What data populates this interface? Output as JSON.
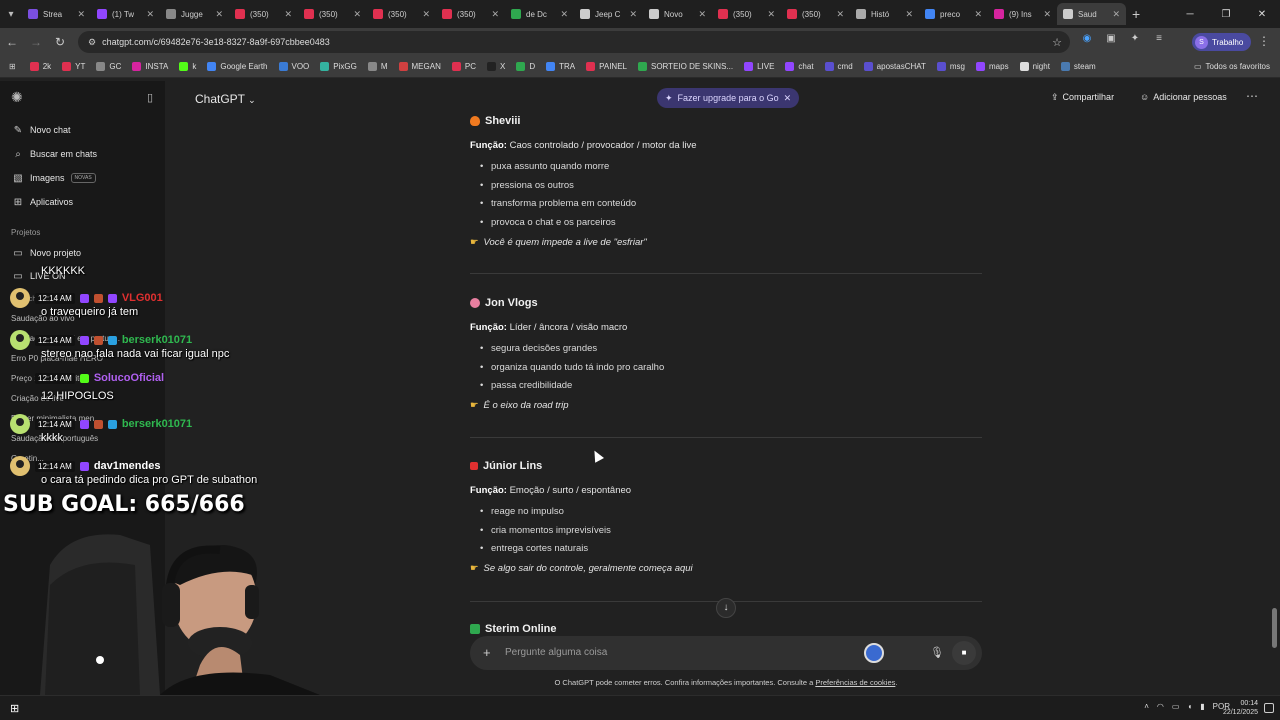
{
  "browser": {
    "tabs": [
      {
        "title": "Strea",
        "color": "#7b4fe0"
      },
      {
        "title": "(1) Tw",
        "color": "#9146ff"
      },
      {
        "title": "Jugge",
        "color": "#888888"
      },
      {
        "title": "(350)",
        "color": "#e03050"
      },
      {
        "title": "(350)",
        "color": "#e03050"
      },
      {
        "title": "(350)",
        "color": "#e03050"
      },
      {
        "title": "(350)",
        "color": "#e03050"
      },
      {
        "title": "de Dc",
        "color": "#2fa84f"
      },
      {
        "title": "Jeep C",
        "color": "#cccccc"
      },
      {
        "title": "Novo",
        "color": "#cccccc"
      },
      {
        "title": "(350)",
        "color": "#e03050"
      },
      {
        "title": "(350)",
        "color": "#e03050"
      },
      {
        "title": "Histó",
        "color": "#aaaaaa"
      },
      {
        "title": "preco",
        "color": "#4285f4"
      },
      {
        "title": "(9) Ins",
        "color": "#d6249f"
      },
      {
        "title": "Saud",
        "color": "#cccccc",
        "active": true
      }
    ],
    "url": "chatgpt.com/c/69482e76-3e18-8327-8a9f-697cbbee0483",
    "profile_name": "Trabalho",
    "profile_initial": "S",
    "bookmarks": [
      {
        "label": "2k",
        "color": "#e03050"
      },
      {
        "label": "YT",
        "color": "#e03050"
      },
      {
        "label": "GC",
        "color": "#888888"
      },
      {
        "label": "INSTA",
        "color": "#d6249f"
      },
      {
        "label": "k",
        "color": "#53fc18"
      },
      {
        "label": "Google Earth",
        "color": "#4285f4"
      },
      {
        "label": "VOO",
        "color": "#3a7bd5"
      },
      {
        "label": "PixGG",
        "color": "#34b3a0"
      },
      {
        "label": "M",
        "color": "#888888"
      },
      {
        "label": "MEGAN",
        "color": "#d04040"
      },
      {
        "label": "PC",
        "color": "#e03050"
      },
      {
        "label": "X",
        "color": "#222222"
      },
      {
        "label": "D",
        "color": "#2fa84f"
      },
      {
        "label": "TRA",
        "color": "#4285f4"
      },
      {
        "label": "PAINEL",
        "color": "#e03050"
      },
      {
        "label": "SORTEIO DE SKINS...",
        "color": "#2fa84f"
      },
      {
        "label": "LIVE",
        "color": "#9146ff"
      },
      {
        "label": "chat",
        "color": "#9146ff"
      },
      {
        "label": "cmd",
        "color": "#5a4fcf"
      },
      {
        "label": "apostasCHAT",
        "color": "#5a4fcf"
      },
      {
        "label": "msg",
        "color": "#5a4fcf"
      },
      {
        "label": "maps",
        "color": "#9146ff"
      },
      {
        "label": "night",
        "color": "#dddddd"
      },
      {
        "label": "steam",
        "color": "#4a7ab0"
      }
    ],
    "all_favorites": "Todos os favoritos"
  },
  "sidebar": {
    "items": [
      {
        "label": "Novo chat",
        "icon": "pencil-icon"
      },
      {
        "label": "Buscar em chats",
        "icon": "search-icon"
      },
      {
        "label": "Imagens",
        "icon": "image-icon",
        "badge": "NOVAS"
      },
      {
        "label": "Aplicativos",
        "icon": "apps-icon"
      }
    ],
    "projects_heading": "Projetos",
    "new_project": "Novo projeto",
    "history": [
      "LIVE ON",
      "Seus chats",
      "Saudação ao vivo",
      "Saudação matinal em portug...",
      "Erro P0 placa-mãe HERO",
      "Preço 100 Bits Twitch",
      "Criação de live",
      "Poster minimalista men...",
      "Saudação em português",
      "Greetin..."
    ]
  },
  "header": {
    "model": "ChatGPT",
    "upgrade": "Fazer upgrade para o Go",
    "share": "Compartilhar",
    "add_people": "Adicionar pessoas"
  },
  "sections": [
    {
      "name": "Sheviii",
      "emoji_color": "#f07a20",
      "role_label": "Função:",
      "role": "Caos controlado / provocador / motor da live",
      "bullets": [
        "puxa assunto quando morre",
        "pressiona os outros",
        "transforma problema em conteúdo",
        "provoca o chat e os parceiros"
      ],
      "note": "Você é quem impede a live de \"esfriar\""
    },
    {
      "name": "Jon Vlogs",
      "emoji_color": "#e87fa0",
      "role_label": "Função:",
      "role": "Líder / âncora / visão macro",
      "bullets": [
        "segura decisões grandes",
        "organiza quando tudo tá indo pro caralho",
        "passa credibilidade"
      ],
      "note": "É o eixo da road trip"
    },
    {
      "name": "Júnior Lins",
      "emoji_color": "#e03030",
      "role_label": "Função:",
      "role": "Emoção / surto / espontâneo",
      "bullets": [
        "reage no impulso",
        "cria momentos imprevisíveis",
        "entrega cortes naturais"
      ],
      "note": "Se algo sair do controle, geralmente começa aqui"
    },
    {
      "name": "Sterim Online",
      "emoji_color": "#2fa84f"
    }
  ],
  "composer": {
    "placeholder": "Pergunte alguma coisa"
  },
  "disclaimer": {
    "text": "O ChatGPT pode cometer erros. Confira informações importantes. Consulte a ",
    "link": "Preferências de cookies",
    "end": "."
  },
  "stream_chat": [
    {
      "time": "",
      "user": "",
      "user_color": "#ffffff",
      "message": "KKKKKK"
    },
    {
      "time": "12:14 AM",
      "user": "VLG001",
      "user_color": "#e03030",
      "message": "o travequeiro já tem"
    },
    {
      "time": "12:14 AM",
      "user": "berserk01071",
      "user_color": "#2fb84f",
      "message": "stereo nao fala nada vai ficar igual npc"
    },
    {
      "time": "12:14 AM",
      "user": "SolucoOficial",
      "user_color": "#b060f0",
      "message": "12 HIPOGLOS"
    },
    {
      "time": "12:14 AM",
      "user": "berserk01071",
      "user_color": "#2fb84f",
      "message": "kkkk"
    },
    {
      "time": "12:14 AM",
      "user": "dav1mendes",
      "user_color": "#ffffff",
      "message": "o cara tá pedindo dica pro GPT de subathon"
    }
  ],
  "sub_goal": "SUB GOAL: 665/666",
  "taskbar": {
    "language": "POR",
    "time": "00:14",
    "date": "22/12/2025"
  }
}
